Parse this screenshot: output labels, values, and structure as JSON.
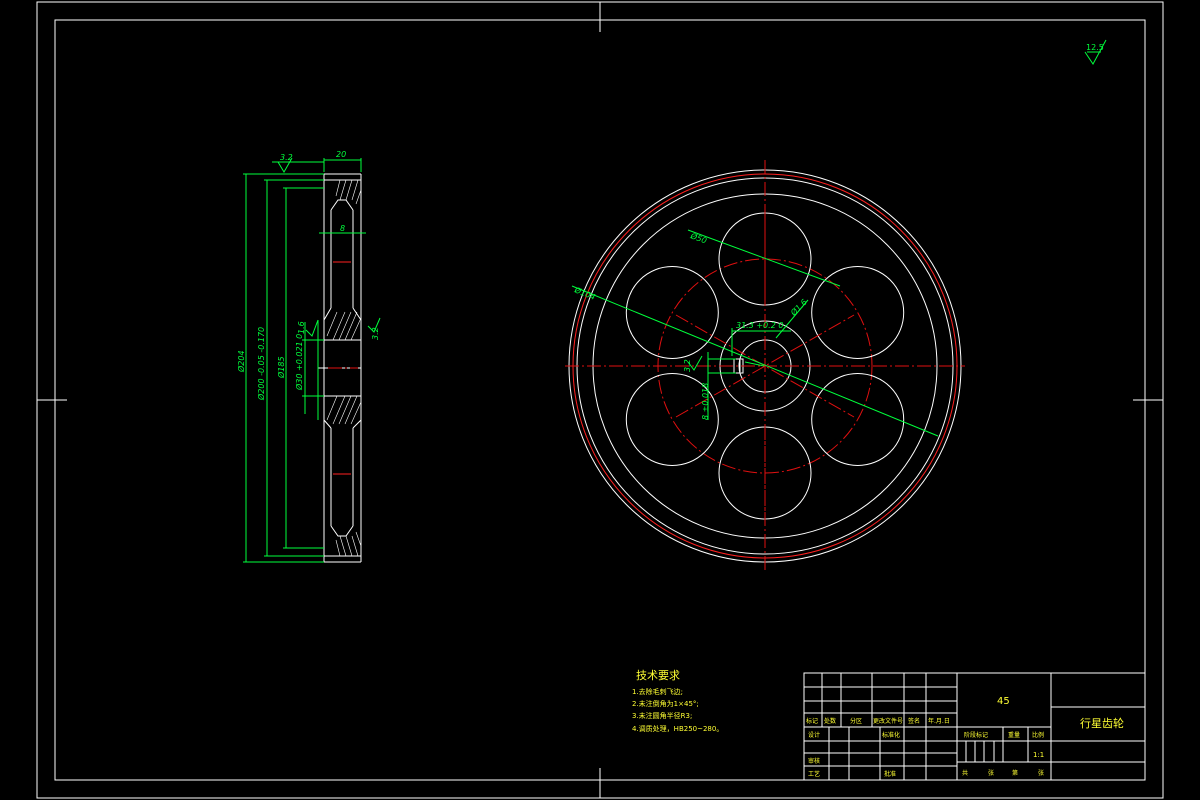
{
  "roughness": {
    "top_right": "12.5",
    "side_top": "3.2",
    "bore": "1.6",
    "key": "3.2"
  },
  "side_view": {
    "width_dim": "20",
    "web_dim": "8",
    "dia_outer": "Ø204",
    "dia_pitch": "Ø200 -0.05 -0.170",
    "dia_root": "Ø185",
    "dia_bore": "Ø30 +0.021 0",
    "dia_hub": "Ø48"
  },
  "front_view": {
    "hole_dia": "Ø50",
    "hole_pcd": "Ø104",
    "key_depth": "31.3 +0.2 0",
    "key_width": "8 ±0.018",
    "chamfer": "Ø1.6",
    "small_rough": "3.2"
  },
  "tech_requirements": {
    "title": "技术要求",
    "items": [
      "1.去除毛刺飞边;",
      "2.未注倒角为1×45°;",
      "3.未注圆角半径R3;",
      "4.调质处理，HB250~280。"
    ]
  },
  "title_block": {
    "material": "45",
    "part_name": "行星齿轮",
    "scale": "1:1",
    "headers": [
      "标记",
      "处数",
      "分区",
      "更改文件号",
      "签名",
      "年.月.日"
    ],
    "design": "设计",
    "standardize": "标准化",
    "stage_mark": "阶段标记",
    "weight": "重量",
    "ratio": "比例",
    "check": "审核",
    "process": "工艺",
    "approve": "批准",
    "sheets": [
      "共",
      "张",
      "第",
      "张"
    ]
  }
}
